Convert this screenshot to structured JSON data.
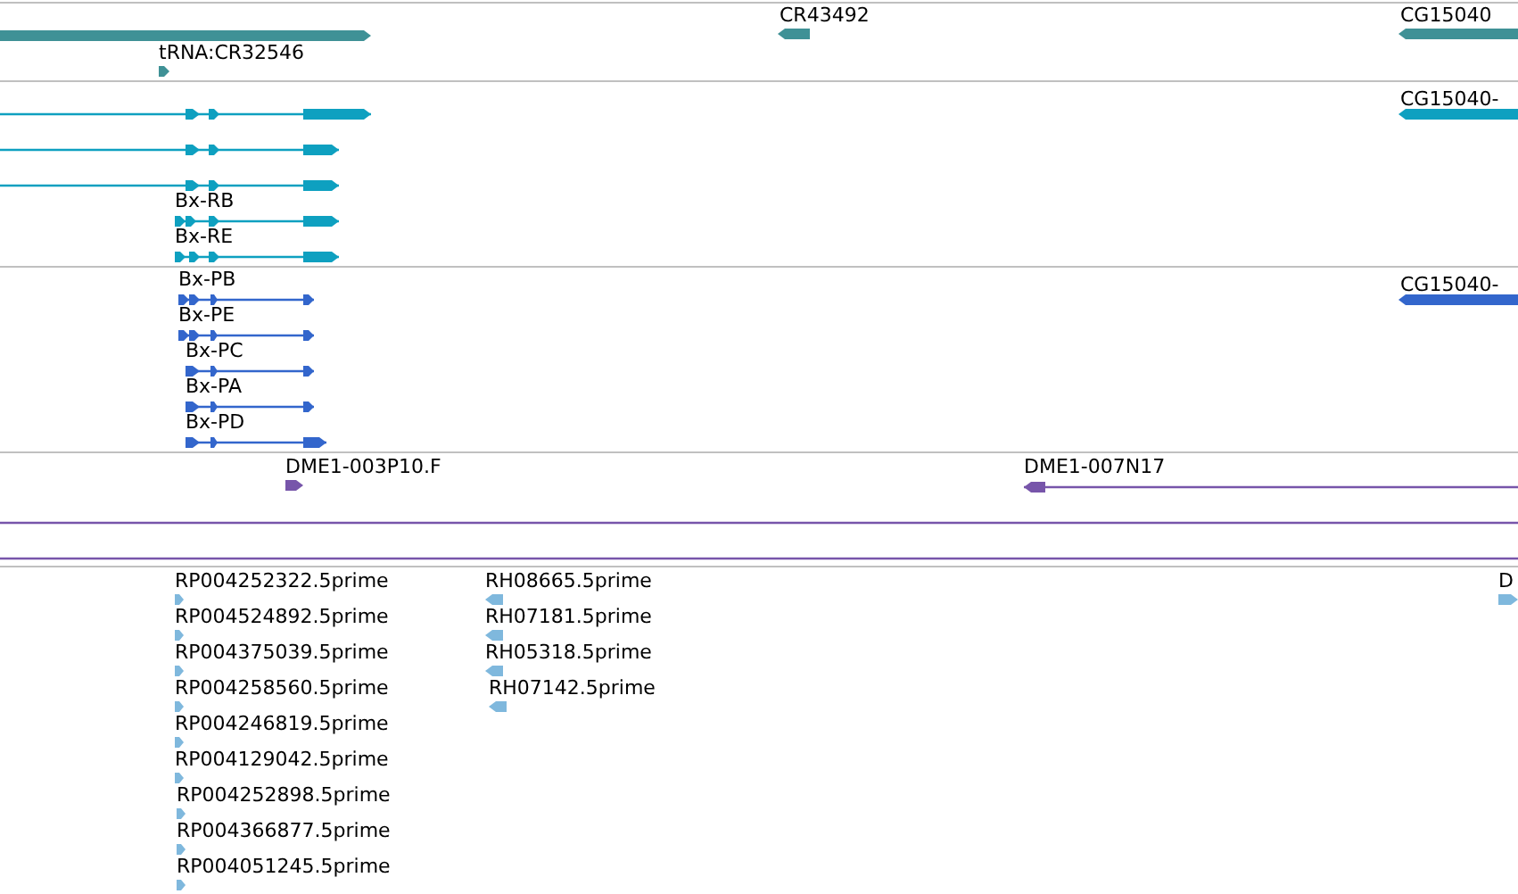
{
  "tracks": [
    {
      "color": "#3f9196",
      "features": [
        {
          "reverse": false
        },
        {
          "label": "CR43492",
          "reverse": true
        },
        {
          "label": "CG15040",
          "reverse": true
        },
        {
          "label": "tRNA:CR32546",
          "reverse": false
        }
      ]
    },
    {
      "color": "#0ea0c0",
      "features": [
        {
          "reverse": false
        },
        {
          "label": "CG15040-",
          "reverse": true
        },
        {
          "reverse": false
        },
        {
          "reverse": false
        },
        {
          "label": "Bx-RB",
          "reverse": false
        },
        {
          "label": "Bx-RE",
          "reverse": false
        }
      ]
    },
    {
      "color": "#3366cc",
      "features": [
        {
          "label": "Bx-PB",
          "reverse": false
        },
        {
          "label": "CG15040-",
          "reverse": true
        },
        {
          "label": "Bx-PE",
          "reverse": false
        },
        {
          "label": "Bx-PC",
          "reverse": false
        },
        {
          "label": "Bx-PA",
          "reverse": false
        },
        {
          "label": "Bx-PD",
          "reverse": false
        }
      ]
    },
    {
      "color": "#7755aa",
      "features": [
        {
          "kind": "arrow",
          "label": "DME1-003P10.F",
          "reverse": false
        },
        {
          "kind": "arrow",
          "label": "DME1-007N17",
          "reverse": true
        },
        {
          "kind": "line"
        },
        {
          "kind": "line"
        }
      ]
    },
    {
      "color": "#7fb8dd",
      "features": [
        {
          "label": "RP004252322.5prime",
          "reverse": false
        },
        {
          "label": "RP004524892.5prime",
          "reverse": false
        },
        {
          "label": "RP004375039.5prime",
          "reverse": false
        },
        {
          "label": "RP004258560.5prime",
          "reverse": false
        },
        {
          "label": "RP004246819.5prime",
          "reverse": false
        },
        {
          "label": "RP004129042.5prime",
          "reverse": false
        },
        {
          "label": "RP004252898.5prime",
          "reverse": false
        },
        {
          "label": "RP004366877.5prime",
          "reverse": false
        },
        {
          "label": "RP004051245.5prime",
          "reverse": false
        },
        {
          "label": "RH08665.5prime",
          "reverse": true
        },
        {
          "label": "RH07181.5prime",
          "reverse": true
        },
        {
          "label": "RH05318.5prime",
          "reverse": true
        },
        {
          "label": "RH07142.5prime",
          "reverse": true
        },
        {
          "label": "D",
          "reverse": false
        }
      ]
    }
  ]
}
